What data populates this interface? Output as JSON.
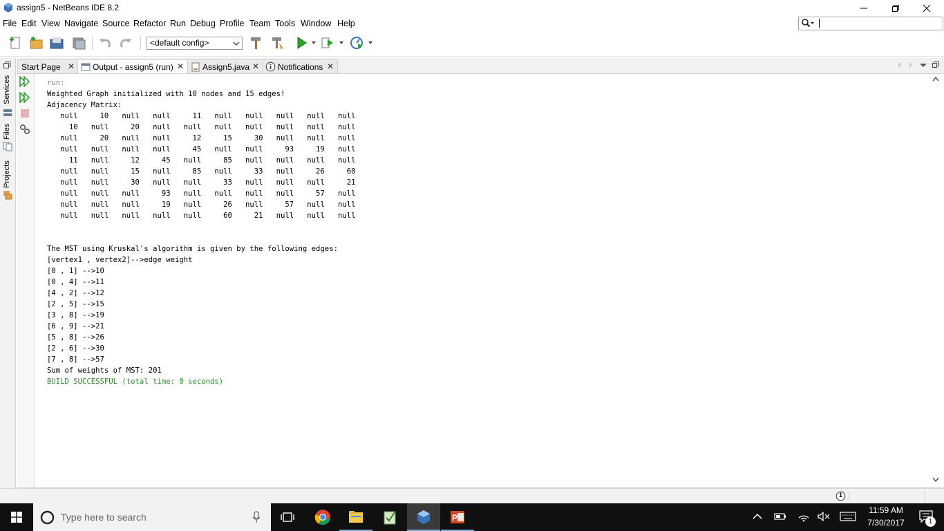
{
  "window": {
    "title": "assign5 - NetBeans IDE 8.2"
  },
  "menu": [
    "File",
    "Edit",
    "View",
    "Navigate",
    "Source",
    "Refactor",
    "Run",
    "Debug",
    "Profile",
    "Team",
    "Tools",
    "Window",
    "Help"
  ],
  "toolbar": {
    "config": "<default config>"
  },
  "side_panels": {
    "services": "Services",
    "files": "Files",
    "projects": "Projects"
  },
  "tabs": [
    {
      "label": "Start Page",
      "active": false
    },
    {
      "label": "Output - assign5 (run)",
      "active": true
    },
    {
      "label": "Assign5.java",
      "active": false
    },
    {
      "label": "Notifications",
      "active": false
    }
  ],
  "output": {
    "run_label": "run:",
    "init_line": "Weighted Graph initialized with 10 nodes and 15 edges!",
    "matrix_header": "Adjacency Matrix:",
    "matrix": [
      [
        "null",
        "10",
        "null",
        "null",
        "11",
        "null",
        "null",
        "null",
        "null",
        "null"
      ],
      [
        "10",
        "null",
        "20",
        "null",
        "null",
        "null",
        "null",
        "null",
        "null",
        "null"
      ],
      [
        "null",
        "20",
        "null",
        "null",
        "12",
        "15",
        "30",
        "null",
        "null",
        "null"
      ],
      [
        "null",
        "null",
        "null",
        "null",
        "45",
        "null",
        "null",
        "93",
        "19",
        "null"
      ],
      [
        "11",
        "null",
        "12",
        "45",
        "null",
        "85",
        "null",
        "null",
        "null",
        "null"
      ],
      [
        "null",
        "null",
        "15",
        "null",
        "85",
        "null",
        "33",
        "null",
        "26",
        "60"
      ],
      [
        "null",
        "null",
        "30",
        "null",
        "null",
        "33",
        "null",
        "null",
        "null",
        "21"
      ],
      [
        "null",
        "null",
        "null",
        "93",
        "null",
        "null",
        "null",
        "null",
        "57",
        "null"
      ],
      [
        "null",
        "null",
        "null",
        "19",
        "null",
        "26",
        "null",
        "57",
        "null",
        "null"
      ],
      [
        "null",
        "null",
        "null",
        "null",
        "null",
        "60",
        "21",
        "null",
        "null",
        "null"
      ]
    ],
    "mst_header": "The MST using Kruskal's algorithm is given by the following edges:",
    "mst_format": "[vertex1 , vertex2]-->edge weight",
    "mst_edges": [
      "[0 , 1] -->10",
      "[0 , 4] -->11",
      "[4 , 2] -->12",
      "[2 , 5] -->15",
      "[3 , 8] -->19",
      "[6 , 9] -->21",
      "[5 , 8] -->26",
      "[2 , 6] -->30",
      "[7 , 8] -->57"
    ],
    "sum_line": "Sum of weights of MST: 201",
    "build_line": "BUILD SUCCESSFUL (total time: 0 seconds)"
  },
  "status": {
    "notification_count": "1"
  },
  "taskbar": {
    "search_placeholder": "Type here to search",
    "time": "11:59 AM",
    "date": "7/30/2017",
    "notification_badge": "1"
  }
}
